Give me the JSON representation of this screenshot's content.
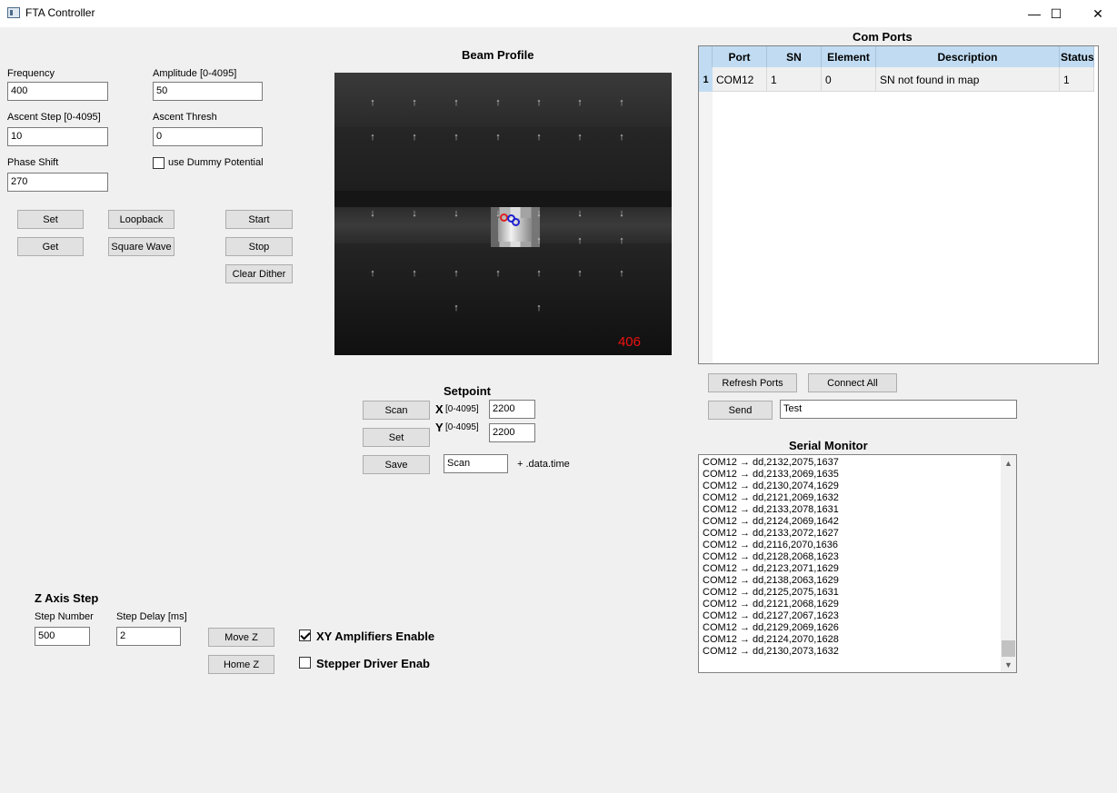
{
  "window": {
    "title": "FTA Controller",
    "minimize": "—",
    "maximize": "☐",
    "close": "✕"
  },
  "params": {
    "frequency": {
      "label": "Frequency",
      "value": "400"
    },
    "amplitude": {
      "label": "Amplitude [0-4095]",
      "value": "50"
    },
    "ascent_step": {
      "label": "Ascent Step [0-4095]",
      "value": "10"
    },
    "ascent_thresh": {
      "label": "Ascent Thresh",
      "value": "0"
    },
    "phase_shift": {
      "label": "Phase Shift",
      "value": "270"
    },
    "dummy_potential": {
      "label": "use Dummy Potential",
      "checked": false
    }
  },
  "buttons": {
    "set": "Set",
    "get": "Get",
    "loopback": "Loopback",
    "square_wave": "Square Wave",
    "start": "Start",
    "stop": "Stop",
    "clear_dither": "Clear Dither"
  },
  "beam": {
    "title": "Beam Profile",
    "count": "406",
    "arrow_up": "↑",
    "arrow_down": "↓"
  },
  "setpoint": {
    "title": "Setpoint",
    "scan_button": "Scan",
    "set_button": "Set",
    "save_button": "Save",
    "x_label": "X",
    "x_range": "[0-4095]",
    "x_value": "2200",
    "y_label": "Y",
    "y_range": "[0-4095]",
    "y_value": "2200",
    "filename_value": "Scan",
    "filename_suffix": "+ .data.time"
  },
  "z_axis": {
    "title": "Z Axis Step",
    "step_number_label": "Step Number",
    "step_number_value": "500",
    "step_delay_label": "Step Delay [ms]",
    "step_delay_value": "2",
    "move_button": "Move Z",
    "home_button": "Home Z"
  },
  "toggles": {
    "xy_amplifiers": {
      "label": "XY Amplifiers Enable",
      "checked": true
    },
    "stepper_driver": {
      "label": "Stepper Driver Enab",
      "checked": false
    }
  },
  "com_ports": {
    "title": "Com Ports",
    "columns": [
      "Port",
      "SN",
      "Element",
      "Description",
      "Status"
    ],
    "rows": [
      {
        "index": "1",
        "cells": [
          "COM12",
          "1",
          "0",
          "SN not found in map",
          "1"
        ]
      }
    ],
    "refresh_button": "Refresh Ports",
    "connect_button": "Connect All",
    "send_button": "Send",
    "send_value": "Test"
  },
  "serial_monitor": {
    "title": "Serial Monitor",
    "lines": [
      "COM12 → dd,2132,2075,1637",
      "COM12 → dd,2133,2069,1635",
      "COM12 → dd,2130,2074,1629",
      "COM12 → dd,2121,2069,1632",
      "COM12 → dd,2133,2078,1631",
      "COM12 → dd,2124,2069,1642",
      "COM12 → dd,2133,2072,1627",
      "COM12 → dd,2116,2070,1636",
      "COM12 → dd,2128,2068,1623",
      "COM12 → dd,2123,2071,1629",
      "COM12 → dd,2138,2063,1629",
      "COM12 → dd,2125,2075,1631",
      "COM12 → dd,2121,2068,1629",
      "COM12 → dd,2127,2067,1623",
      "COM12 → dd,2129,2069,1626",
      "COM12 → dd,2124,2070,1628",
      "COM12 → dd,2130,2073,1632"
    ],
    "scroll_up": "▲",
    "scroll_down": "▼"
  }
}
